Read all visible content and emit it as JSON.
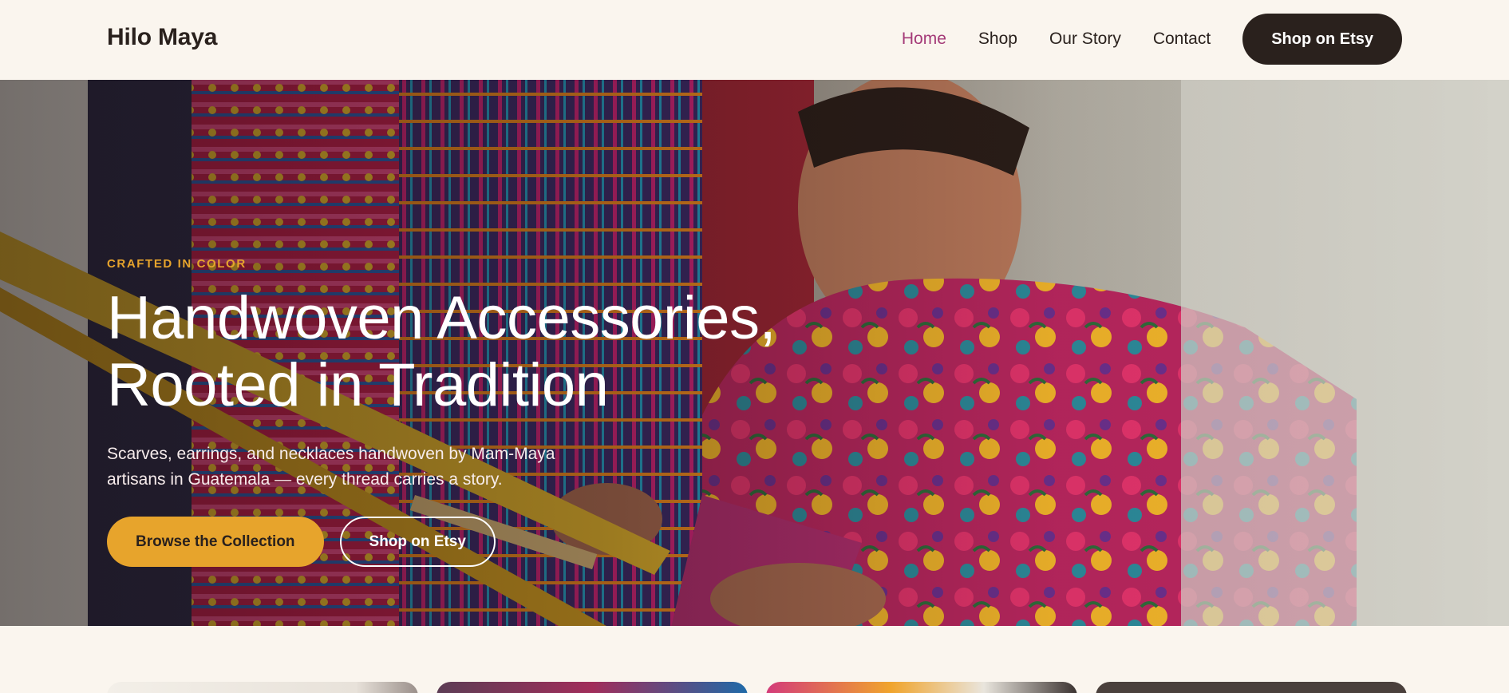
{
  "header": {
    "brand": "Hilo Maya",
    "nav": [
      {
        "label": "Home",
        "active": true
      },
      {
        "label": "Shop",
        "active": false
      },
      {
        "label": "Our Story",
        "active": false
      },
      {
        "label": "Contact",
        "active": false
      }
    ],
    "cta_label": "Shop on Etsy"
  },
  "hero": {
    "eyebrow": "CRAFTED IN COLOR",
    "title_line1": "Handwoven Accessories,",
    "title_line2": "Rooted in Tradition",
    "subtitle_line1": "Scarves, earrings, and necklaces handwoven by Mam-Maya",
    "subtitle_line2": "artisans in Guatemala — every thread carries a story.",
    "primary_button": "Browse the Collection",
    "secondary_button": "Shop on Etsy"
  },
  "colors": {
    "background": "#faf5ee",
    "text": "#2a211d",
    "accent_gold": "#e7a42c",
    "nav_active": "#a43a78",
    "dark_button": "#2a211d"
  }
}
